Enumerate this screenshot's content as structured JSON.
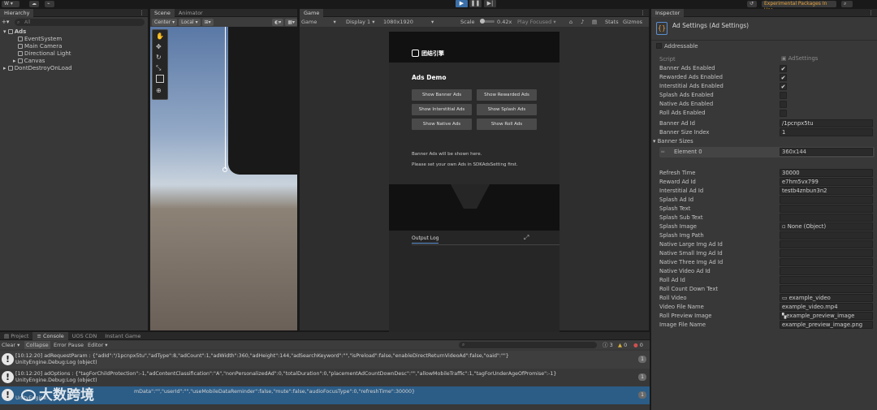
{
  "topbar": {
    "account": "W",
    "experimental": "Experimental Packages In Use ▾"
  },
  "hierarchy": {
    "tab": "Hierarchy",
    "search_placeholder": "All",
    "scene": "Ads",
    "items": [
      "EventSystem",
      "Main Camera",
      "Directional Light",
      "Canvas"
    ],
    "ddol": "DontDestroyOnLoad"
  },
  "scene": {
    "tabs": [
      "Scene",
      "Animator"
    ],
    "pivot": "Center",
    "space": "Local"
  },
  "game": {
    "tab": "Game",
    "mode": "Game",
    "display": "Display 1",
    "resolution": "1080x1920",
    "scale_label": "Scale",
    "scale_value": "0.42x",
    "play_focused": "Play Focused",
    "stats": "Stats",
    "gizmos": "Gizmos",
    "phone": {
      "logo": "团结引擎",
      "heading": "Ads Demo",
      "buttons": [
        "Show Banner Ads",
        "Show Rewarded Ads",
        "Show Interstitial Ads",
        "Show Splash Ads",
        "Show Native Ads",
        "Show Roll Ads"
      ],
      "msg1": "Banner Ads will be shown here.",
      "msg2": "Please set your own Ads in SDKAdsSetting first.",
      "output_tab": "Output Log"
    }
  },
  "inspector": {
    "tab": "Inspector",
    "title": "Ad Settings (Ad Settings)",
    "addressable": "Addressable",
    "script_label": "Script",
    "script_value": "AdSettings",
    "checks": [
      {
        "label": "Banner Ads Enabled",
        "mark": "✔"
      },
      {
        "label": "Rewarded Ads Enabled",
        "mark": "✔"
      },
      {
        "label": "Interstitial Ads Enabled",
        "mark": "✔"
      },
      {
        "label": "Splash Ads Enabled",
        "mark": ""
      },
      {
        "label": "Native Ads Enabled",
        "mark": ""
      },
      {
        "label": "Roll Ads Enabled",
        "mark": ""
      }
    ],
    "banner_ad_id": {
      "label": "Banner Ad Id",
      "value": "/1pcnpx5tu"
    },
    "banner_size_index": {
      "label": "Banner Size Index",
      "value": "1"
    },
    "banner_sizes": {
      "label": "Banner Sizes",
      "element_label": "Element 0",
      "element_value": "360x144"
    },
    "fields": [
      {
        "label": "Refresh Time",
        "value": "30000"
      },
      {
        "label": "Reward Ad Id",
        "value": "e7hm5vx799"
      },
      {
        "label": "Interstitial Ad Id",
        "value": "testb4znbun3n2"
      },
      {
        "label": "Splash Ad Id",
        "value": ""
      },
      {
        "label": "Splash Text",
        "value": ""
      },
      {
        "label": "Splash Sub Text",
        "value": ""
      },
      {
        "label": "Splash Image",
        "value": "None (Object)"
      },
      {
        "label": "Splash Img Path",
        "value": ""
      },
      {
        "label": "Native Large Img Ad Id",
        "value": ""
      },
      {
        "label": "Native Small Img Ad Id",
        "value": ""
      },
      {
        "label": "Native Three Img Ad Id",
        "value": ""
      },
      {
        "label": "Native Video Ad Id",
        "value": ""
      },
      {
        "label": "Roll Ad Id",
        "value": ""
      },
      {
        "label": "Roll Count Down Text",
        "value": ""
      },
      {
        "label": "Roll Video",
        "value": "example_video"
      },
      {
        "label": "Video File Name",
        "value": "example_video.mp4"
      },
      {
        "label": "Roll Preview Image",
        "value": "example_preview_image"
      },
      {
        "label": "Image File Name",
        "value": "example_preview_image.png"
      }
    ]
  },
  "console": {
    "tabs": [
      "Project",
      "Console",
      "UOS CDN",
      "Instant Game"
    ],
    "toolbar": [
      "Clear",
      "Collapse",
      "Error Pause",
      "Editor ▾"
    ],
    "counts": [
      "3",
      "0",
      "0"
    ],
    "logs": [
      {
        "line1": "[10:12:20] adRequestParam : {\"adId\":\"/1pcnpx5tu\",\"adType\":8,\"adCount\":1,\"adWidth\":360,\"adHeight\":144,\"adSearchKeyword\":\"\",\"isPreload\":false,\"enableDirectReturnVideoAd\":false,\"oaid\":\"\"}",
        "line2": "UnityEngine.Debug:Log (object)",
        "count": "1"
      },
      {
        "line1": "[10:12:20] adOptions : {\"tagForChildProtection\":-1,\"adContentClassification\":\"A\",\"nonPersonalizedAd\":0,\"totalDuration\":0,\"placementAdCountDownDesc\":\"\",\"allowMobileTraffic\":1,\"tagForUnderAgeOfPromise\":-1}",
        "line2": "UnityEngine.Debug:Log (object)",
        "count": "1"
      },
      {
        "line1": "mData\":\"\",\"userId\":\"\",\"useMobileDataReminder\":false,\"mute\":false,\"audioFocusType\":0,\"refreshTime\":30000}",
        "line2": "UnityEngine.",
        "count": "1"
      }
    ],
    "watermark": "大数跨境"
  }
}
